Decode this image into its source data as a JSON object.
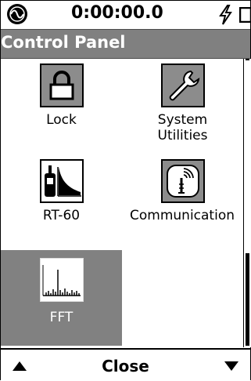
{
  "status": {
    "timer": "0:00:00.0",
    "icons": [
      "logo-icon",
      "bolt-icon",
      "battery-icon"
    ]
  },
  "title": "Control Panel",
  "grid": [
    {
      "label": "Lock",
      "icon": "lock-icon"
    },
    {
      "label": "System Utilities",
      "icon": "wrench-icon"
    },
    {
      "label": "RT-60",
      "icon": "rt60-icon"
    },
    {
      "label": "Communication",
      "icon": "antenna-icon"
    },
    {
      "label": "FFT",
      "icon": "fft-icon",
      "selected": true
    }
  ],
  "softkeys": {
    "left": "up-arrow-icon",
    "center": "Close",
    "right": "down-arrow-icon"
  },
  "colors": {
    "title_bg": "#808080",
    "selected_bg": "#818181"
  }
}
